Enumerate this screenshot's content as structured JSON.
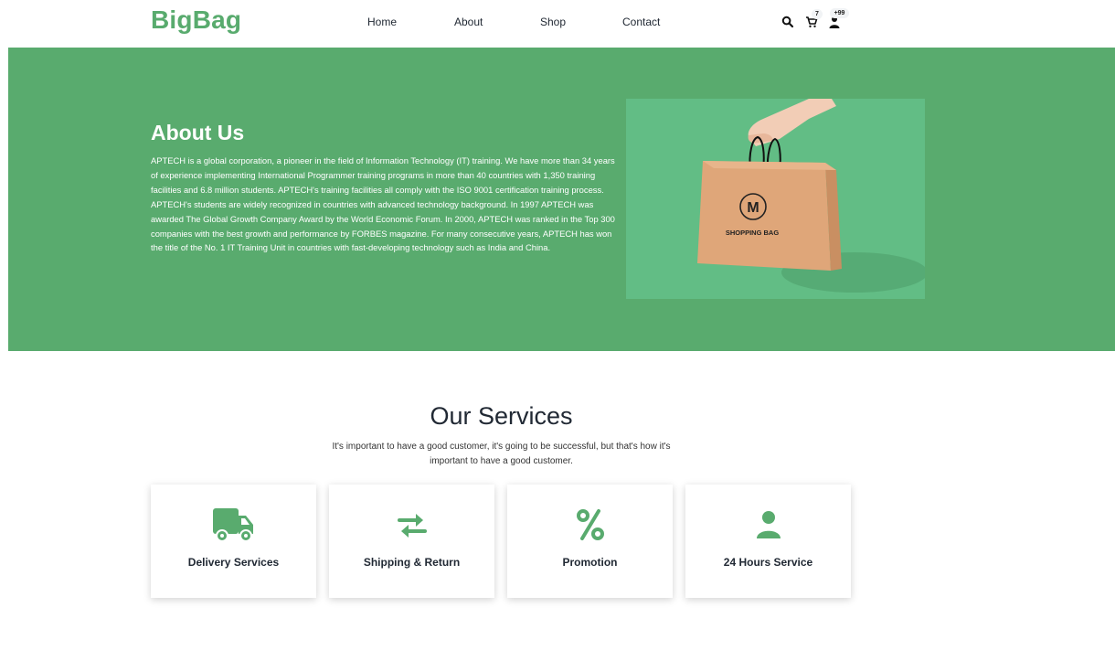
{
  "brand": {
    "logo": "BigBag",
    "accent": "#59ab6e"
  },
  "nav": {
    "items": [
      {
        "label": "Home"
      },
      {
        "label": "About"
      },
      {
        "label": "Shop"
      },
      {
        "label": "Contact"
      }
    ]
  },
  "header_icons": {
    "search": "search-icon",
    "cart": "cart-icon",
    "user": "user-icon",
    "cart_count": "7",
    "user_count": "+99"
  },
  "hero": {
    "title": "About Us",
    "text": "APTECH is a global corporation, a pioneer in the field of Information Technology (IT) training. We have more than 34 years of experience implementing International Programmer training programs in more than 40 countries with 1,350 training facilities and 6.8 million students. APTECH's training facilities all comply with the ISO 9001 certification training process. APTECH's students are widely recognized in countries with advanced technology background. In 1997 APTECH was awarded The Global Growth Company Award by the World Economic Forum. In 2000, APTECH was ranked in the Top 300 companies with the best growth and performance by FORBES magazine. For many consecutive years, APTECH has won the title of the No. 1 IT Training Unit in countries with fast-developing technology such as India and China.",
    "image": {
      "bag_letter": "M",
      "bag_text": "SHOPPING BAG",
      "bg_color": "#62bd85"
    }
  },
  "services": {
    "title": "Our Services",
    "subtitle": "It's important to have a good customer, it's going to be successful, but that's how it's important to have a good customer.",
    "items": [
      {
        "label": "Delivery Services",
        "icon": "truck-icon"
      },
      {
        "label": "Shipping & Return",
        "icon": "exchange-icon"
      },
      {
        "label": "Promotion",
        "icon": "percent-icon"
      },
      {
        "label": "24 Hours Service",
        "icon": "user-icon"
      }
    ]
  }
}
